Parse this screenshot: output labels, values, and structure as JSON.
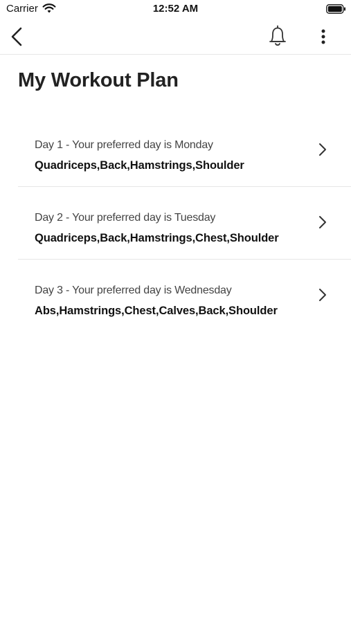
{
  "status_bar": {
    "carrier": "Carrier",
    "time": "12:52 AM",
    "icons": [
      "wifi-icon",
      "battery-icon"
    ]
  },
  "nav": {
    "icons": [
      "back-chevron-icon",
      "bell-icon",
      "more-vertical-icon"
    ]
  },
  "page": {
    "title": "My Workout Plan"
  },
  "plan": {
    "items": [
      {
        "subtitle": "Day 1 - Your preferred day is Monday",
        "muscles": "Quadriceps,Back,Hamstrings,Shoulder"
      },
      {
        "subtitle": "Day 2 - Your preferred day is Tuesday",
        "muscles": "Quadriceps,Back,Hamstrings,Chest,Shoulder"
      },
      {
        "subtitle": "Day 3 - Your preferred day is Wednesday",
        "muscles": "Abs,Hamstrings,Chest,Calves,Back,Shoulder"
      }
    ]
  },
  "colors": {
    "text_primary": "#111111",
    "text_secondary": "#444444",
    "divider": "#e6e6e6",
    "background": "#ffffff"
  }
}
